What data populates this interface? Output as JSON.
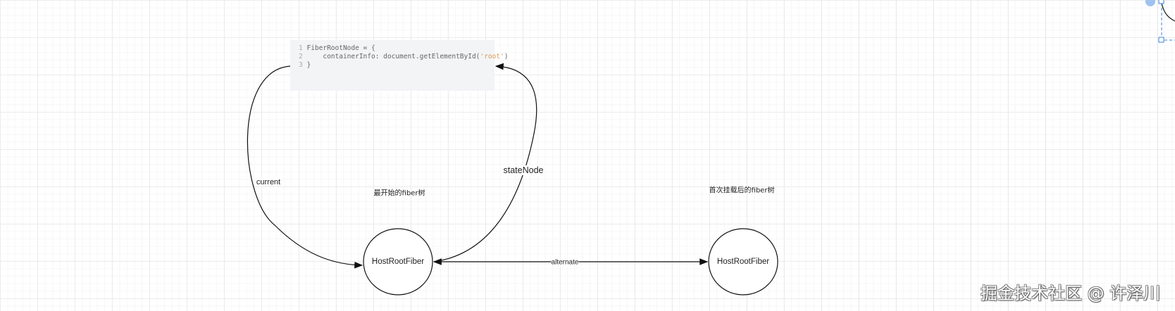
{
  "code_block": {
    "lines": [
      {
        "num": "1",
        "text": "FiberRootNode = {"
      },
      {
        "num": "2",
        "text": "    containerInfo: document.getElementById(",
        "string": "'root'",
        "after": ")"
      },
      {
        "num": "3",
        "text": "}"
      }
    ]
  },
  "edges": {
    "current": "current",
    "stateNode": "stateNode",
    "alternate": "alternate"
  },
  "nodes": {
    "left": "HostRootFiber",
    "right": "HostRootFiber"
  },
  "notes": {
    "left": "最开始的fiber树",
    "right": "首次挂载后的fiber树"
  },
  "watermark": "掘金技术社区 @ 许泽川",
  "colors": {
    "selection": "#3b82d6",
    "code_bg": "#f3f4f6"
  }
}
